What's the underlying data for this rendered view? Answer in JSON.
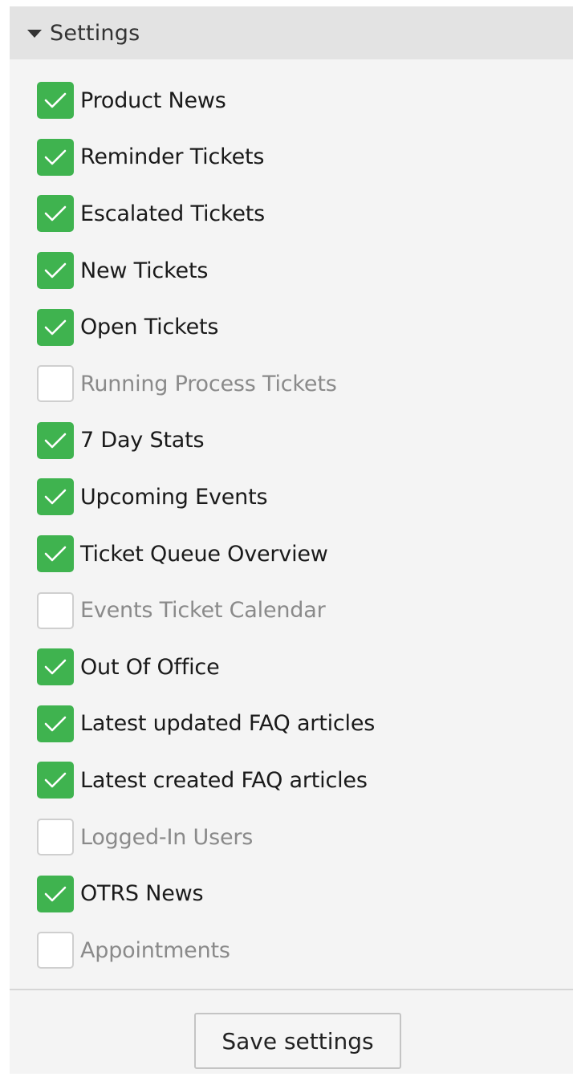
{
  "panel": {
    "title": "Settings",
    "toggle_icon": "caret-down-icon"
  },
  "options": [
    {
      "label": "Product News",
      "checked": true
    },
    {
      "label": "Reminder Tickets",
      "checked": true
    },
    {
      "label": "Escalated Tickets",
      "checked": true
    },
    {
      "label": "New Tickets",
      "checked": true
    },
    {
      "label": "Open Tickets",
      "checked": true
    },
    {
      "label": "Running Process Tickets",
      "checked": false
    },
    {
      "label": "7 Day Stats",
      "checked": true
    },
    {
      "label": "Upcoming Events",
      "checked": true
    },
    {
      "label": "Ticket Queue Overview",
      "checked": true
    },
    {
      "label": "Events Ticket Calendar",
      "checked": false
    },
    {
      "label": "Out Of Office",
      "checked": true
    },
    {
      "label": "Latest updated FAQ articles",
      "checked": true
    },
    {
      "label": "Latest created FAQ articles",
      "checked": true
    },
    {
      "label": "Logged-In Users",
      "checked": false
    },
    {
      "label": "OTRS News",
      "checked": true
    },
    {
      "label": "Appointments",
      "checked": false
    }
  ],
  "footer": {
    "save_label": "Save settings"
  },
  "colors": {
    "checked": "#3fb34f",
    "header_bg": "#e3e3e3",
    "panel_bg": "#f4f4f4",
    "unchecked_text": "#8a8a8a"
  }
}
